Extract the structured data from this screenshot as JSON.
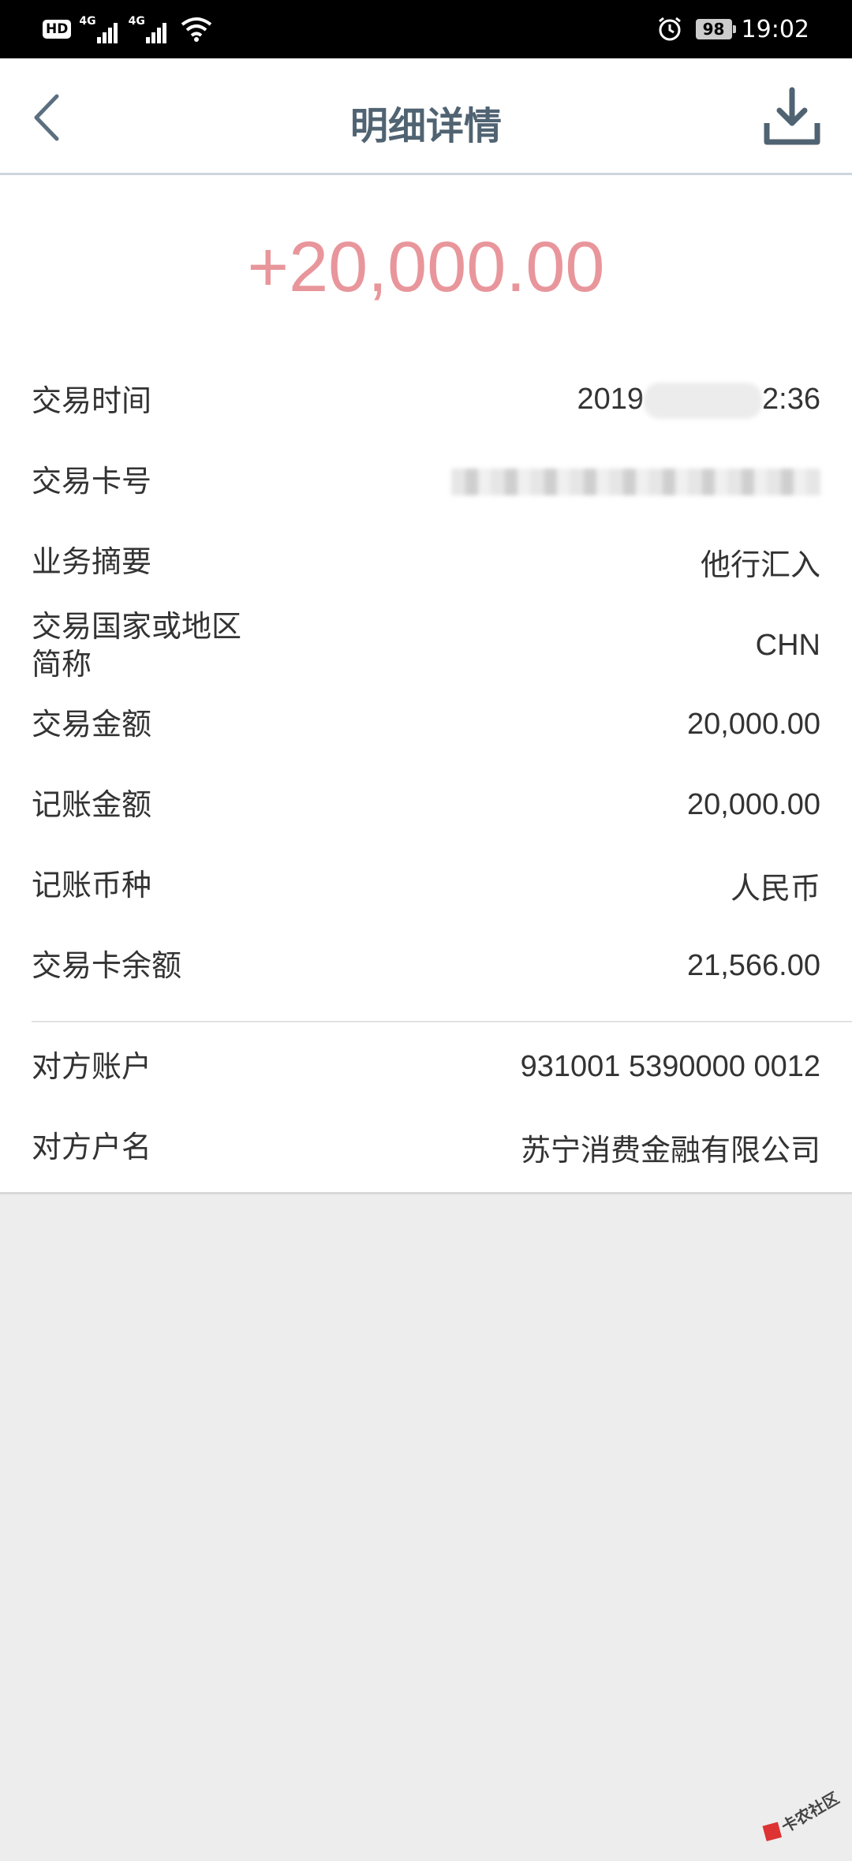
{
  "status_bar": {
    "hd": "HD",
    "net1": "4G",
    "net2": "4G",
    "battery": "98",
    "time": "19:02"
  },
  "header": {
    "title": "明细详情",
    "back_icon": "chevron-left-icon",
    "download_icon": "download-icon"
  },
  "detail": {
    "amount": "+20,000.00",
    "amount_color": "#e8969b",
    "rows": [
      {
        "label": "交易时间",
        "value_prefix": "2019",
        "value_suffix": "2:36"
      },
      {
        "label": "交易卡号",
        "value": ""
      },
      {
        "label": "业务摘要",
        "value": "他行汇入"
      },
      {
        "label": "交易国家或地区简称",
        "value": "CHN"
      },
      {
        "label": "交易金额",
        "value": "20,000.00"
      },
      {
        "label": "记账金额",
        "value": "20,000.00"
      },
      {
        "label": "记账币种",
        "value": "人民币"
      },
      {
        "label": "交易卡余额",
        "value": "21,566.00"
      }
    ],
    "counterparty": [
      {
        "label": "对方账户",
        "value": "931001 5390000 0012"
      },
      {
        "label": "对方户名",
        "value": "苏宁消费金融有限公司"
      }
    ]
  },
  "watermark": {
    "text": "卡农社区"
  },
  "colors": {
    "title": "#506372",
    "background": "#ededed"
  }
}
